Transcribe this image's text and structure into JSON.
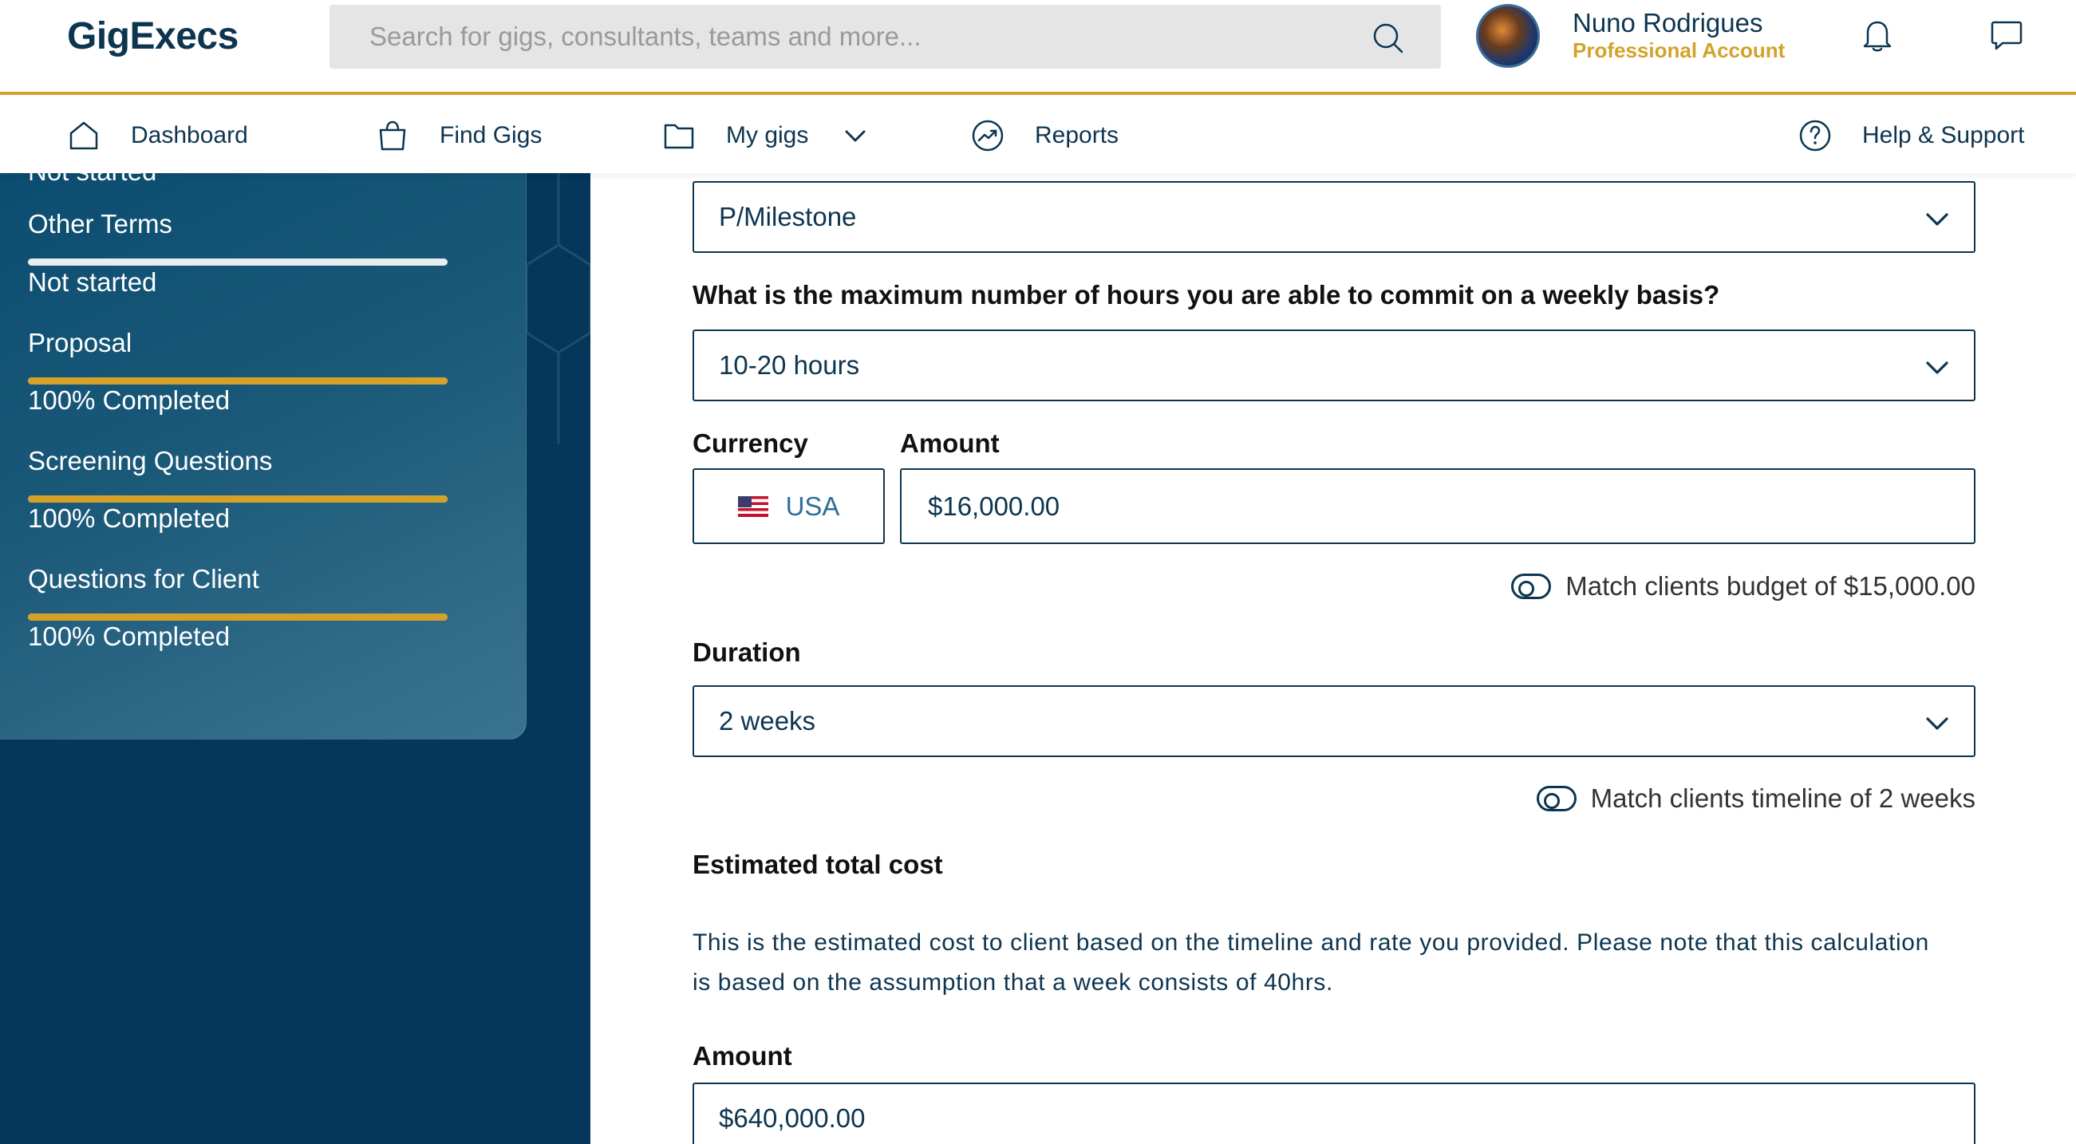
{
  "header": {
    "logo": "GigExecs",
    "search_placeholder": "Search for gigs, consultants, teams and more...",
    "user_name": "Nuno Rodrigues",
    "user_role": "Professional Account"
  },
  "nav": {
    "items": [
      {
        "label": "Dashboard",
        "icon": "home-icon"
      },
      {
        "label": "Find Gigs",
        "icon": "bag-icon"
      },
      {
        "label": "My gigs",
        "icon": "folder-icon"
      },
      {
        "label": "Reports",
        "icon": "trend-icon"
      },
      {
        "label": "Help & Support",
        "icon": "help-icon"
      }
    ]
  },
  "sidebar": {
    "steps": [
      {
        "title": "",
        "status": "Not started",
        "progress": 0
      },
      {
        "title": "Other Terms",
        "status": "Not started",
        "progress": 0
      },
      {
        "title": "Proposal",
        "status": "100% Completed",
        "progress": 100
      },
      {
        "title": "Screening Questions",
        "status": "100% Completed",
        "progress": 100
      },
      {
        "title": "Questions for Client",
        "status": "100% Completed",
        "progress": 100
      }
    ]
  },
  "form": {
    "payment_type_value": "P/Milestone",
    "hours_label": "What is the maximum number of hours you are able to commit on a weekly basis?",
    "hours_value": "10-20 hours",
    "currency_label": "Currency",
    "currency_value": "USA",
    "amount_label": "Amount",
    "amount_value": "$16,000.00",
    "match_budget": "Match clients budget of $15,000.00",
    "duration_label": "Duration",
    "duration_value": "2 weeks",
    "match_timeline": "Match clients timeline of 2 weeks",
    "estimated_label": "Estimated total cost",
    "estimated_desc": "This is the estimated cost to client based on the timeline and rate you provided. Please note that this calculation is based on the assumption that a week consists of 40hrs.",
    "total_amount_label": "Amount",
    "total_amount_value": "$640,000.00"
  },
  "colors": {
    "brand_navy": "#0d3550",
    "accent_gold": "#d4a22b",
    "sidebar_bg": "#04375a"
  }
}
